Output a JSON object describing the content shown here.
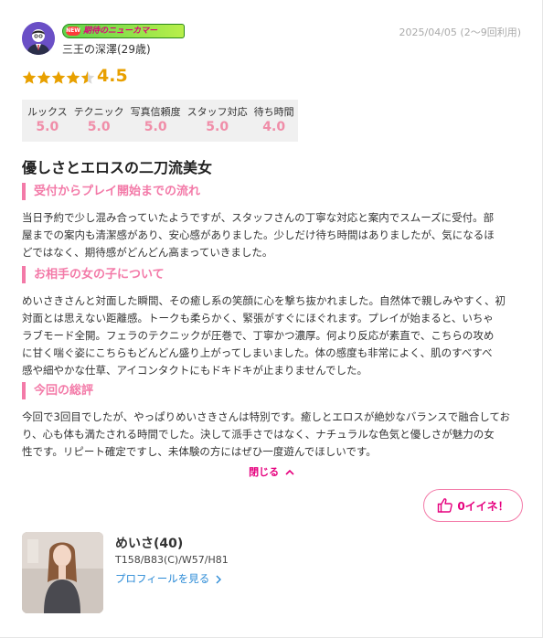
{
  "reviewer": {
    "badge_mark": "NEW",
    "badge_text": "期待のニューカマー",
    "name": "三王の深澤(29歳)",
    "date": "2025/04/05 (2〜9回利用)"
  },
  "rating": {
    "score": "4.5",
    "stars_value": 4.5,
    "stars_max": 5
  },
  "subscores": [
    {
      "label": "ルックス",
      "value": "5.0"
    },
    {
      "label": "テクニック",
      "value": "5.0"
    },
    {
      "label": "写真信頼度",
      "value": "5.0"
    },
    {
      "label": "スタッフ対応",
      "value": "5.0"
    },
    {
      "label": "待ち時間",
      "value": "4.0"
    }
  ],
  "review": {
    "title": "優しさとエロスの二刀流美女",
    "sections": [
      {
        "heading": "受付からプレイ開始までの流れ",
        "lines": [
          "当日予約で少し混み合っていたようですが、スタッフさんの丁寧な対応と案内でスムーズに受付。部",
          "屋までの案内も清潔感があり、安心感がありました。少しだけ待ち時間はありましたが、気になるほ",
          "どではなく、期待感がどんどん高まっていきました。"
        ]
      },
      {
        "heading": "お相手の女の子について",
        "lines": [
          "めいさきさんと対面した瞬間、その癒し系の笑顔に心を撃ち抜かれました。自然体で親しみやすく、初",
          "対面とは思えない距離感。トークも柔らかく、緊張がすぐにほぐれます。プレイが始まると、いちゃ",
          "ラブモード全開。フェラのテクニックが圧巻で、丁寧かつ濃厚。何より反応が素直で、こちらの攻め",
          "に甘く喘ぐ姿にこちらもどんどん盛り上がってしまいました。体の感度も非常によく、肌のすべすべ",
          "感や細やかな仕草、アイコンタクトにもドキドキが止まりませんでした。"
        ]
      },
      {
        "heading": "今回の総評",
        "lines": [
          "今回で3回目でしたが、やっぱりめいさきさんは特別です。癒しとエロスが絶妙なバランスで融合してお",
          "り、心も体も満たされる時間でした。決して派手さではなく、ナチュラルな色気と優しさが魅力の女",
          "性です。リピート確定ですし、未体験の方にはぜひ一度遊んでほしいです。"
        ]
      }
    ],
    "close_label": "閉じる",
    "close_icon": "chevron-up-icon"
  },
  "like": {
    "label": "0イイネ！",
    "icon": "thumbs-up-icon"
  },
  "girl": {
    "name": "めいさ(40)",
    "stats": "T158/B83(C)/W57/H81",
    "profile_link": "プロフィールを見る"
  },
  "colors": {
    "accent_pink": "#f37aa8",
    "like_pink": "#e6007e",
    "star_gold": "#e8a000",
    "link_blue": "#2a8ad6",
    "subscore_pink": "#f08da8"
  }
}
